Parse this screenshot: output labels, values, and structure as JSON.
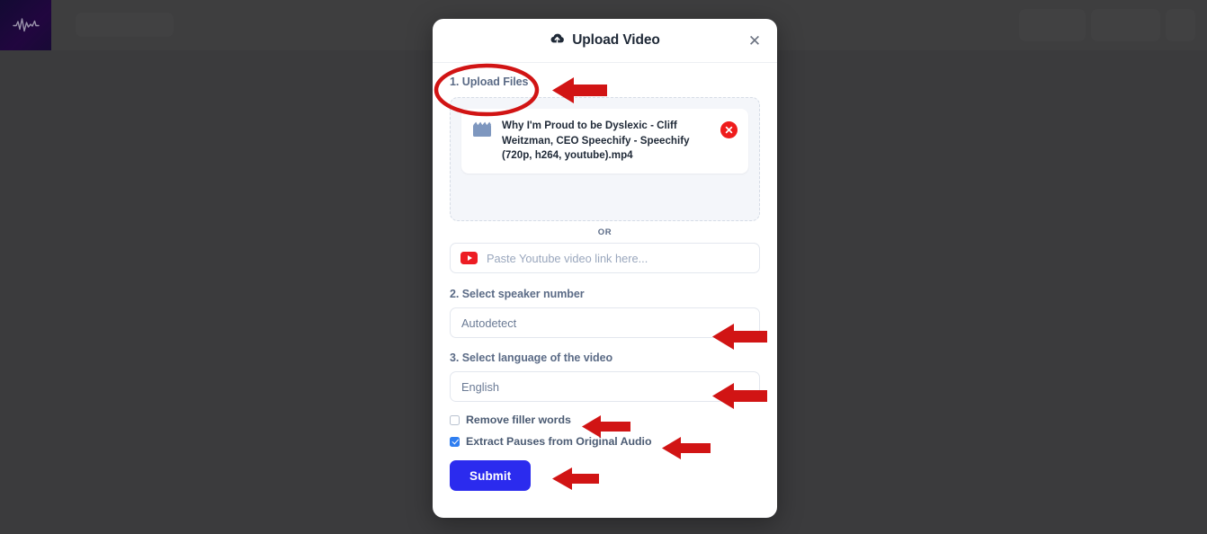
{
  "background": {
    "logo_icon": "waveform-logo-icon",
    "search_placeholder_skeleton": "",
    "buttons": [
      "",
      "",
      ""
    ]
  },
  "modal": {
    "title": "Upload Video",
    "title_icon": "cloud-upload-icon",
    "close_icon": "close-icon",
    "step1_label": "1. Upload Files",
    "dropzone": {
      "file": {
        "icon": "clapperboard-icon",
        "name": "Why I'm Proud to be Dyslexic - Cliff Weitzman, CEO Speechify - Speechify (720p, h264, youtube).mp4",
        "remove_icon": "remove-file-icon"
      }
    },
    "or_text": "OR",
    "youtube": {
      "icon": "youtube-icon",
      "placeholder": "Paste Youtube video link here...",
      "value": ""
    },
    "step2_label": "2. Select speaker number",
    "speaker_value": "Autodetect",
    "step3_label": "3. Select language of the video",
    "language_value": "English",
    "checkbox1": {
      "label": "Remove filler words",
      "checked": false
    },
    "checkbox2": {
      "label": "Extract Pauses from Original Audio",
      "checked": true
    },
    "submit_label": "Submit"
  },
  "annotations": {
    "ellipse_target": "1. Upload Files",
    "arrows": [
      "arrow-to-upload-files",
      "arrow-to-speaker-select",
      "arrow-to-language-select",
      "arrow-to-remove-filler-words",
      "arrow-to-extract-pauses",
      "arrow-to-submit"
    ],
    "color": "#d11414"
  }
}
